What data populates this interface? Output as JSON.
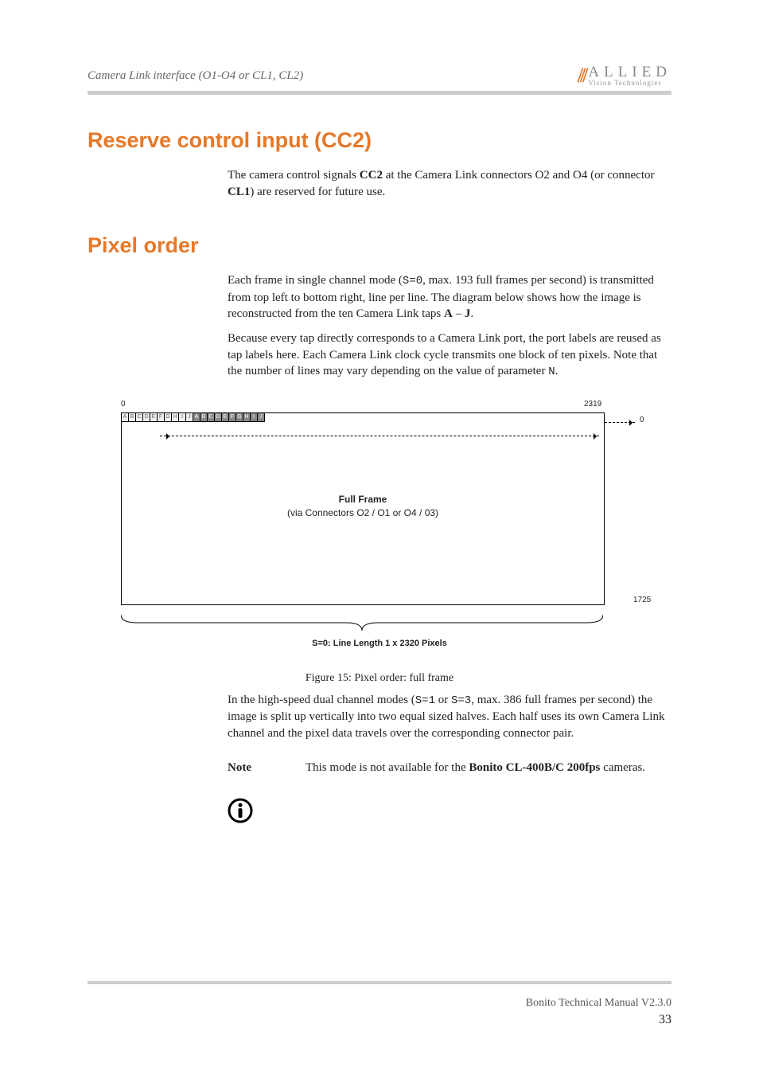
{
  "header": {
    "running_title": "Camera Link interface (O1-O4 or CL1, CL2)",
    "logo_main": "ALLIED",
    "logo_sub": "Vision Technologies"
  },
  "sections": {
    "reserve": {
      "heading": "Reserve control input (CC2)",
      "p1a": "The camera control signals ",
      "p1b": "CC2",
      "p1c": " at the Camera Link connectors O2 and O4 (or connector ",
      "p1d": "CL1",
      "p1e": ") are reserved for future use."
    },
    "pixel": {
      "heading": "Pixel order",
      "p1a": "Each frame in single channel mode (",
      "p1b": "S=0",
      "p1c": ", max. 193 full frames per second) is transmitted from top left to bottom right, line per line. The diagram below shows how the image is reconstructed from the ten Camera Link taps ",
      "p1d": "A",
      "p1e": " – ",
      "p1f": "J",
      "p1g": ".",
      "p2a": "Because every tap directly corresponds to a Camera Link port, the port labels are reused as tap labels here. Each Camera Link clock cycle transmits one block of ten pixels. Note that the number of lines may vary depending on the value of parameter ",
      "p2b": "N",
      "p2c": ".",
      "caption": "Figure 15: Pixel order: full frame",
      "p3a": "In the high-speed dual channel modes (",
      "p3b": "S=1",
      "p3c": " or ",
      "p3d": "S=3",
      "p3e": ", max. 386 full frames per second) the image is split up vertically into two equal sized halves. Each half uses its own Camera Link channel and the pixel data travels over the corresponding connector pair.",
      "note_label": "Note",
      "note_a": "This mode is not available for the ",
      "note_b": "Bonito CL-400B/C 200fps",
      "note_c": " cameras."
    }
  },
  "diagram": {
    "left_coord": "0",
    "right_coord": "2319",
    "side_top": "0",
    "side_bottom": "1725",
    "taps": [
      "A",
      "B",
      "C",
      "D",
      "E",
      "F",
      "G",
      "H",
      "I",
      "J",
      "A",
      "B",
      "C",
      "D",
      "E",
      "F",
      "G",
      "H",
      "I",
      "J"
    ],
    "frame_line1": "Full Frame",
    "frame_line2": "(via Connectors O2 / O1 or O4 / 03)",
    "bottom_caption": "S=0: Line Length 1 x 2320 Pixels"
  },
  "footer": {
    "doc": "Bonito Technical Manual V2.3.0",
    "page": "33"
  }
}
